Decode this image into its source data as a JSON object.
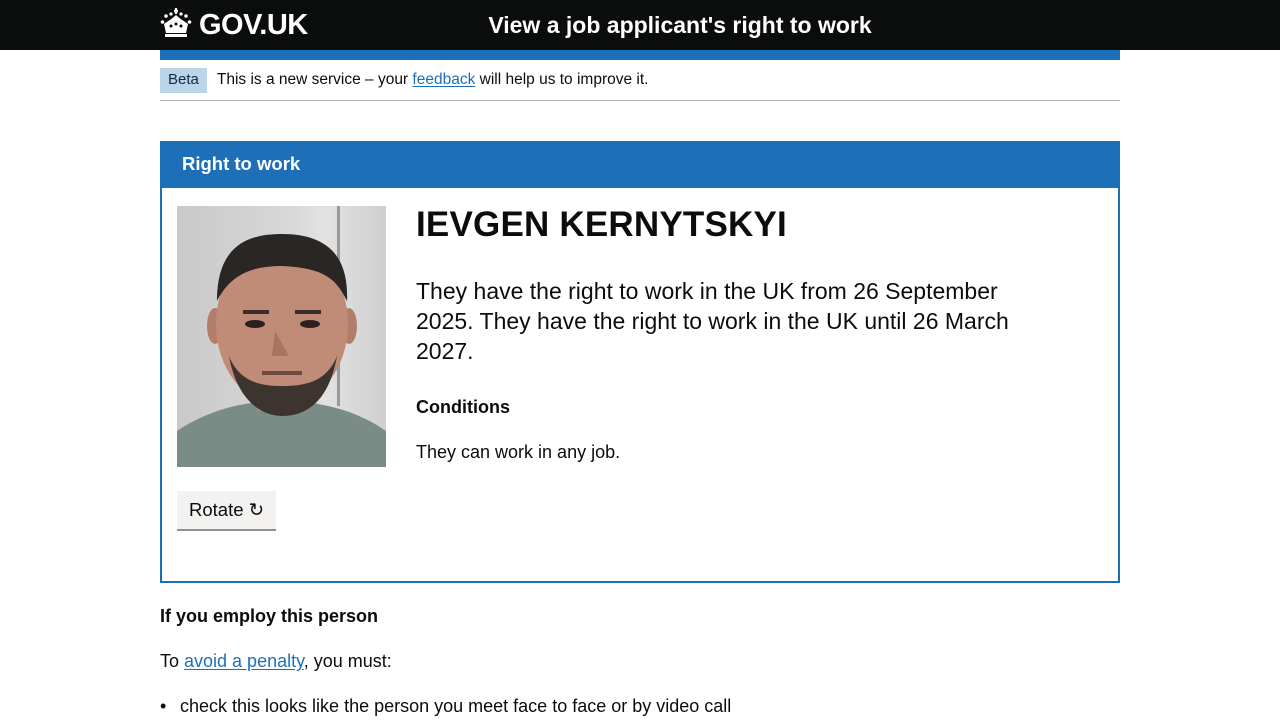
{
  "header": {
    "logo_text": "GOV.UK",
    "logo_icon": "crown-icon",
    "service_name": "View a job applicant's right to work"
  },
  "phase_banner": {
    "tag": "Beta",
    "text_before": "This is a new service – your ",
    "link_text": "feedback",
    "text_after": " will help us to improve it."
  },
  "panel": {
    "title": "Right to work",
    "name": "IEVGEN KERNYTSKYI",
    "status_text": "They have the right to work in the UK from 26 September 2025. They have the right to work in the UK until 26 March 2027.",
    "conditions_heading": "Conditions",
    "conditions_text": "They can work in any job.",
    "rotate_label": "Rotate ↻"
  },
  "employ": {
    "heading": "If you employ this person",
    "intro_before": "To ",
    "intro_link": "avoid a penalty",
    "intro_after": ", you must:",
    "bullets": [
      "check this looks like the person you meet face to face or by video call"
    ]
  },
  "colors": {
    "header_bg": "#0b0c0c",
    "brand_blue": "#1d70b8",
    "tag_bg": "#bbd4ea",
    "button_bg": "#f3f2f1"
  }
}
